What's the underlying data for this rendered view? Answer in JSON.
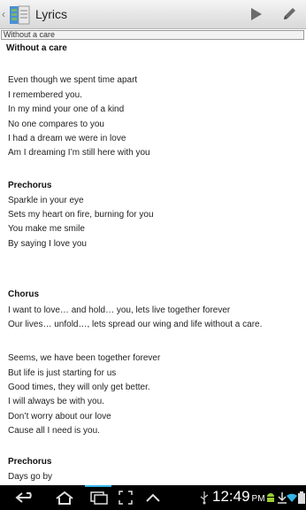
{
  "app": {
    "title": "Lyrics",
    "accent": "#33b5e5"
  },
  "toolbar": {
    "play_icon": "play-icon",
    "edit_icon": "pencil-icon"
  },
  "title_field": {
    "value": "Without a care"
  },
  "song": {
    "title": "Without a care",
    "lines": [
      {
        "text": "Even though we spent time apart",
        "heading": false
      },
      {
        "text": "I remembered you.",
        "heading": false
      },
      {
        "text": "In my mind your one of a kind",
        "heading": false
      },
      {
        "text": "No one compares to you",
        "heading": false
      },
      {
        "text": "I had a dream we were in love",
        "heading": false
      },
      {
        "text": "Am I dreaming I’m still here with you",
        "heading": false
      },
      {
        "text": "Prechorus",
        "heading": true
      },
      {
        "text": "Sparkle in your eye",
        "heading": false
      },
      {
        "text": "Sets my heart on fire, burning for you",
        "heading": false
      },
      {
        "text": "You make me smile",
        "heading": false
      },
      {
        "text": "By saying I love you",
        "heading": false
      },
      {
        "text": "Chorus",
        "heading": true
      },
      {
        "text": "I want to love… and hold… you, lets live together forever",
        "heading": false
      },
      {
        "text": "Our lives… unfold…, lets spread our wing and life without a care.",
        "heading": false
      },
      {
        "text": "Seems, we have been together forever",
        "heading": false
      },
      {
        "text": "But life is just starting for us",
        "heading": false
      },
      {
        "text": "Good times, they will only get better.",
        "heading": false
      },
      {
        "text": "I will always be with you.",
        "heading": false
      },
      {
        "text": "Don’t worry about our love",
        "heading": false
      },
      {
        "text": "Cause all I need is you.",
        "heading": false
      },
      {
        "text": "Prechorus",
        "heading": true
      },
      {
        "text": "Days go by",
        "heading": false
      }
    ]
  },
  "system_bar": {
    "time": "12:49",
    "time_suffix": "PM",
    "icons": [
      "back-icon",
      "home-icon",
      "recent-apps-icon",
      "screenshot-icon",
      "up-chevron-icon",
      "usb-icon",
      "android-icon",
      "download-icon",
      "wifi-icon",
      "battery-icon"
    ]
  }
}
